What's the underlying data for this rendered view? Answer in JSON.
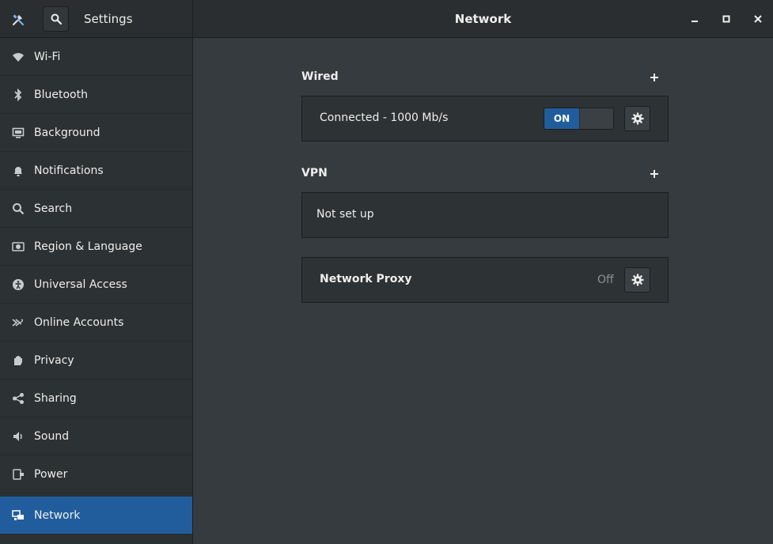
{
  "header": {
    "app_title": "Settings",
    "page_title": "Network"
  },
  "sidebar": {
    "items": [
      {
        "label": "Wi-Fi",
        "icon": "wifi-icon"
      },
      {
        "label": "Bluetooth",
        "icon": "bluetooth-icon"
      },
      {
        "label": "Background",
        "icon": "background-icon"
      },
      {
        "label": "Notifications",
        "icon": "bell-icon"
      },
      {
        "label": "Search",
        "icon": "search-icon"
      },
      {
        "label": "Region & Language",
        "icon": "region-icon"
      },
      {
        "label": "Universal Access",
        "icon": "accessibility-icon"
      },
      {
        "label": "Online Accounts",
        "icon": "online-accounts-icon"
      },
      {
        "label": "Privacy",
        "icon": "hand-icon"
      },
      {
        "label": "Sharing",
        "icon": "share-icon"
      },
      {
        "label": "Sound",
        "icon": "speaker-icon"
      },
      {
        "label": "Power",
        "icon": "power-plug-icon"
      },
      {
        "label": "Network",
        "icon": "network-icon",
        "active": true
      }
    ]
  },
  "main": {
    "wired": {
      "title": "Wired",
      "status": "Connected - 1000 Mb/s",
      "toggle_label": "ON",
      "toggle_state": true
    },
    "vpn": {
      "title": "VPN",
      "status": "Not set up"
    },
    "proxy": {
      "label": "Network Proxy",
      "state": "Off"
    }
  },
  "colors": {
    "accent": "#215d9c",
    "background": "#353b3e",
    "sidebar": "#2c3133",
    "headerbar": "#2a2e30"
  }
}
